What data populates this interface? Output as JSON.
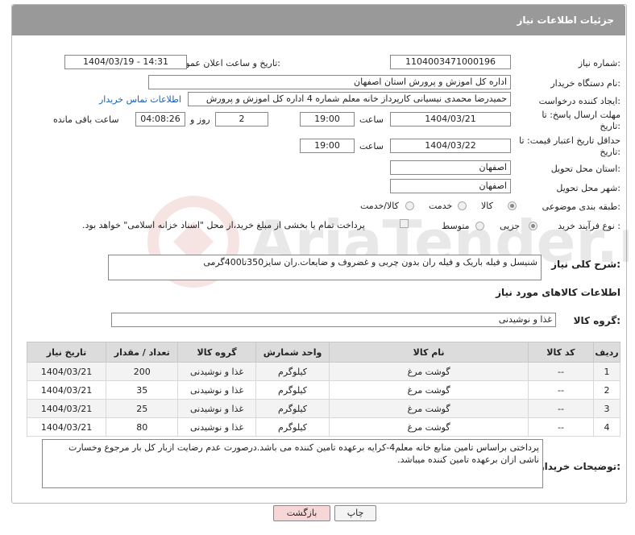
{
  "header": {
    "title": "جزئیات اطلاعات نیاز"
  },
  "form": {
    "need_number_label": "شماره نیاز:",
    "need_number": "1104003471000196",
    "announce_label": "تاریخ و ساعت اعلان عمومی:",
    "announce_value": "1404/03/19 - 14:31",
    "buyer_org_label": "نام دستگاه خریدار:",
    "buyer_org": "اداره کل اموزش و پرورش استان اصفهان",
    "creator_label": "ایجاد کننده درخواست:",
    "creator": "حمیدرضا محمدی نیسیانی کارپرداز خانه معلم شماره 4 اداره کل اموزش و پرورش",
    "contact_link": "اطلاعات تماس خریدار",
    "deadline_label": "مهلت ارسال پاسخ: تا تاریخ:",
    "deadline_date": "1404/03/21",
    "time_label": "ساعت",
    "deadline_time": "19:00",
    "days_value": "2",
    "days_label": "روز و",
    "remaining_time": "04:08:26",
    "remaining_label": "ساعت باقی مانده",
    "validity_label": "حداقل تاریخ اعتبار قیمت: تا تاریخ:",
    "validity_date": "1404/03/22",
    "validity_time": "19:00",
    "province_label": "استان محل تحویل:",
    "province": "اصفهان",
    "city_label": "شهر محل تحویل:",
    "city": "اصفهان",
    "category_label": "طبقه بندی موضوعی:",
    "category_options": [
      "کالا",
      "خدمت",
      "کالا/خدمت"
    ],
    "process_label": "نوع فرآیند خرید :",
    "process_options": [
      "جزیی",
      "متوسط"
    ],
    "payment_note": "پرداخت تمام یا بخشی از مبلغ خرید،از محل \"اسناد خزانه اسلامی\" خواهد بود."
  },
  "summary": {
    "label": "شرح کلی نیاز:",
    "text": "شنیسل و فیله باریک و فیله ران بدون چربی و غضروف و ضایعات.ران سایز350تا400گرمی"
  },
  "goods": {
    "section_title": "اطلاعات کالاهای مورد نیاز",
    "group_label": "گروه کالا:",
    "group_value": "غذا و نوشیدنی",
    "columns": [
      "ردیف",
      "کد کالا",
      "نام کالا",
      "واحد شمارش",
      "گروه کالا",
      "تعداد / مقدار",
      "تاریخ نیاز"
    ],
    "rows": [
      [
        "1",
        "--",
        "گوشت مرغ",
        "کیلوگرم",
        "غذا و نوشیدنی",
        "200",
        "1404/03/21"
      ],
      [
        "2",
        "--",
        "گوشت مرغ",
        "کیلوگرم",
        "غذا و نوشیدنی",
        "35",
        "1404/03/21"
      ],
      [
        "3",
        "--",
        "گوشت مرغ",
        "کیلوگرم",
        "غذا و نوشیدنی",
        "25",
        "1404/03/21"
      ],
      [
        "4",
        "--",
        "گوشت مرغ",
        "کیلوگرم",
        "غذا و نوشیدنی",
        "80",
        "1404/03/21"
      ]
    ]
  },
  "notes": {
    "label": "توضیحات خریدار:",
    "text": "پرداختی براساس تامین منابع خانه معلم4-کرایه برعهده تامین کننده می باشد.درصورت عدم رضایت ازبار کل بار مرجوع وخسارت ناشی ازان برعهده تامین کننده میباشد."
  },
  "buttons": {
    "print": "چاپ",
    "back": "بازگشت"
  },
  "colors": {
    "header_bg": "#999999",
    "link": "#1a5fb4",
    "back_btn_bg": "#f6d6d6"
  }
}
